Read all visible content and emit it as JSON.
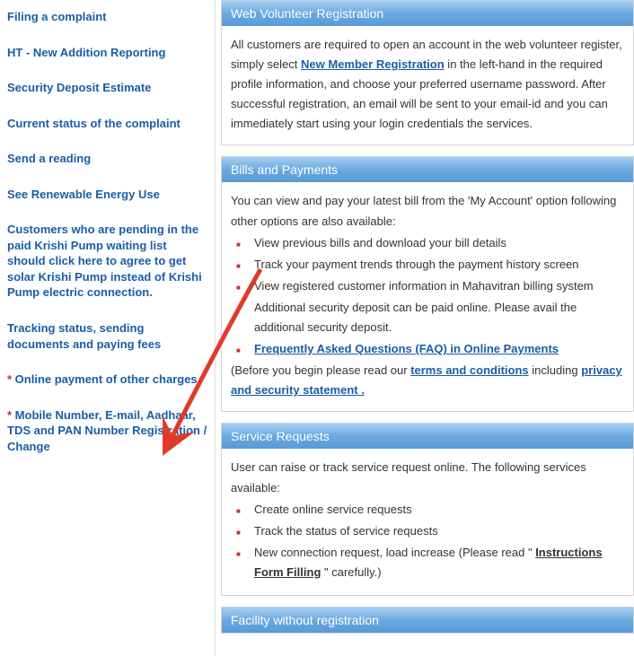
{
  "sidebar": {
    "items": [
      {
        "label": "Filing a complaint"
      },
      {
        "label": "HT - New Addition Reporting"
      },
      {
        "label": "Security Deposit Estimate"
      },
      {
        "label": "Current status of the complaint"
      },
      {
        "label": "Send a reading"
      },
      {
        "label": "See Renewable Energy Use"
      },
      {
        "label": "Customers who are pending in the paid Krishi Pump waiting list should click here to agree to get solar Krishi Pump instead of Krishi Pump electric connection."
      },
      {
        "label": "Tracking status, sending documents and paying fees"
      },
      {
        "prefix": "* ",
        "label": "Online payment of other charges"
      },
      {
        "prefix": "* ",
        "label": "Mobile Number, E-mail, Aadhaar, TDS and PAN Number Registration / Change"
      }
    ]
  },
  "sections": {
    "volunteer": {
      "title": "Web Volunteer Registration",
      "body_pre": "All customers are required to open an account in the web volunteer register, simply select ",
      "link": "New Member Registration",
      "body_post": " in the left-hand in the required profile information, and choose your preferred username password. After successful registration, an email will be sent to your email-id and you can immediately start using your login credentials the services."
    },
    "bills": {
      "title": "Bills and Payments",
      "intro": "You can view and pay your latest bill from the 'My Account' option following other options are also available:",
      "bullets": [
        "View previous bills and download your bill details",
        "Track your payment trends through the payment history screen",
        "View registered customer information in Mahavitran billing system",
        "Additional security deposit can be paid online. Please avail the additional security deposit."
      ],
      "faq_link": "Frequently Asked Questions (FAQ) in Online Payments",
      "before_text_pre": "(Before you begin please read our ",
      "terms_link": "terms and conditions",
      "before_text_mid": " including ",
      "privacy_link": "privacy and security statement ."
    },
    "service": {
      "title": "Service Requests",
      "intro": "User can raise or track service request online. The following services available:",
      "bullets": [
        "Create online service requests",
        "Track the status of service requests"
      ],
      "last_pre": "New connection request, load increase (Please read \" ",
      "last_link": "Instructions Form Filling",
      "last_post": " \" carefully.)"
    },
    "facility": {
      "title": "Facility without registration"
    }
  }
}
